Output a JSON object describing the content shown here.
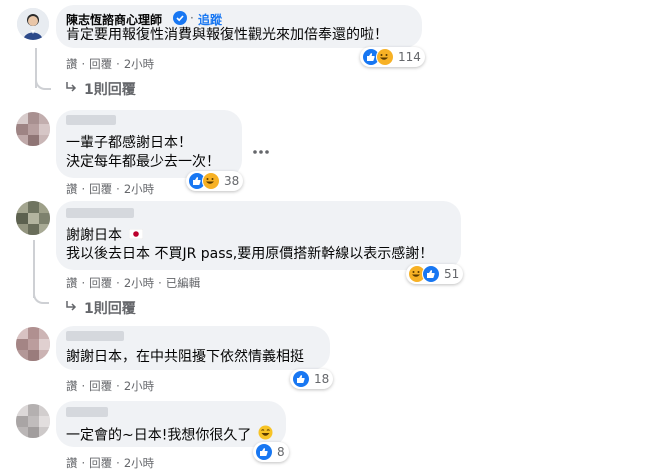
{
  "comments": [
    {
      "author": "陳志恆諮商心理師",
      "follow": "追蹤",
      "lines": [
        "肯定要用報復性消費與報復性觀光來加倍奉還的啦！"
      ],
      "actions": {
        "like": "讚",
        "reply": "回覆",
        "time": "2小時"
      },
      "reaction_count": "114",
      "reply_link": "1則回覆"
    },
    {
      "lines": [
        "一輩子都感謝日本！",
        "決定每年都最少去一次！"
      ],
      "actions": {
        "like": "讚",
        "reply": "回覆",
        "time": "2小時"
      },
      "reaction_count": "38"
    },
    {
      "lines": [
        "謝謝日本",
        "我以後去日本 不買JR pass,要用原價搭新幹線以表示感謝！"
      ],
      "actions": {
        "like": "讚",
        "reply": "回覆",
        "time": "2小時",
        "edited": "已編輯"
      },
      "reaction_count": "51",
      "reply_link": "1則回覆"
    },
    {
      "lines": [
        "謝謝日本，在中共阻擾下依然情義相挺"
      ],
      "actions": {
        "like": "讚",
        "reply": "回覆",
        "time": "2小時"
      },
      "reaction_count": "18"
    },
    {
      "lines": [
        "一定會的~日本!我想你很久了"
      ],
      "actions": {
        "like": "讚",
        "reply": "回覆",
        "time": "2小時"
      },
      "reaction_count": "8"
    }
  ],
  "icons": {
    "verified": "verified-badge-icon",
    "more": "more-options-icon",
    "reply_arrow": "reply-arrow-icon",
    "like": "like-reaction-icon",
    "haha": "haha-reaction-icon",
    "flag": "japan-flag-icon",
    "emoji": "grinning-emoji-icon"
  },
  "colors": {
    "like": "#1877f2",
    "haha": "#f7b125",
    "bubble": "#f0f2f5",
    "meta": "#65676b"
  }
}
